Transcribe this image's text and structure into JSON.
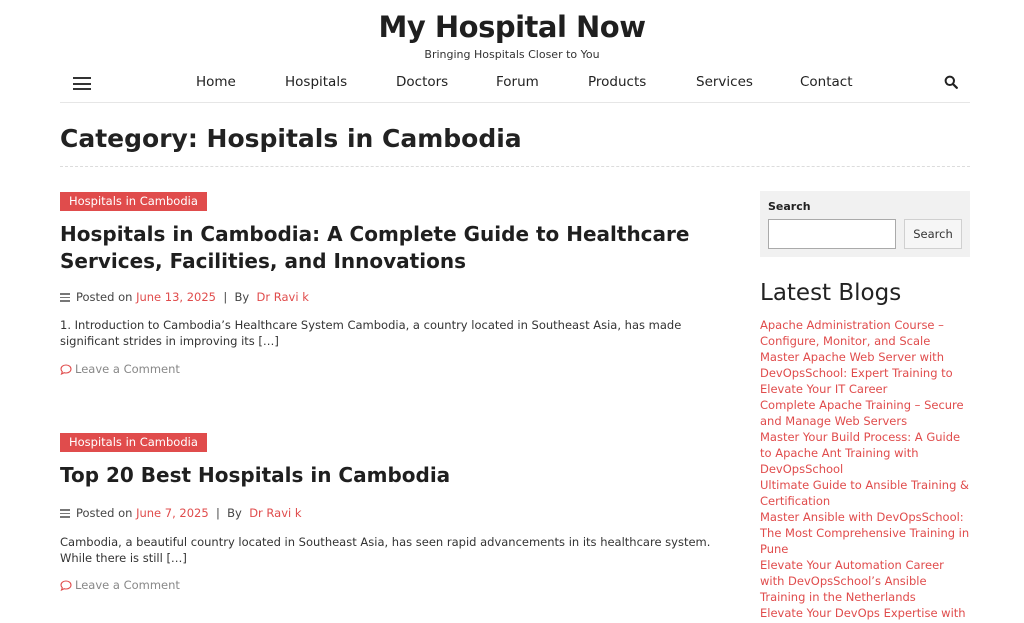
{
  "site": {
    "title": "My Hospital Now",
    "tagline": "Bringing Hospitals Closer to You"
  },
  "nav": {
    "items": [
      "Home",
      "Hospitals",
      "Doctors",
      "Forum",
      "Products",
      "Services",
      "Contact"
    ]
  },
  "category": {
    "title": "Category: Hospitals in Cambodia"
  },
  "posts": [
    {
      "badge": "Hospitals in Cambodia",
      "title": "Hospitals in Cambodia: A Complete Guide to Healthcare Services, Facilities, and Innovations",
      "posted_on": "Posted on",
      "date": "June 13, 2025",
      "sep": "|",
      "by": "By",
      "author": "Dr Ravi k",
      "excerpt": "1. Introduction to Cambodia’s Healthcare System Cambodia, a country located in Southeast Asia, has made significant strides in improving its […]",
      "comment": "Leave a Comment"
    },
    {
      "badge": "Hospitals in Cambodia",
      "title": "Top 20 Best Hospitals in Cambodia",
      "posted_on": "Posted on",
      "date": "June 7, 2025",
      "sep": "|",
      "by": "By",
      "author": "Dr Ravi k",
      "excerpt": "Cambodia, a beautiful country located in Southeast Asia, has seen rapid advancements in its healthcare system. While there is still […]",
      "comment": "Leave a Comment"
    }
  ],
  "sidebar": {
    "search_label": "Search",
    "search_placeholder": "",
    "search_button": "Search",
    "latest_title": "Latest Blogs",
    "blogs": [
      "Apache Administration Course – Configure, Monitor, and Scale",
      "Master Apache Web Server with DevOpsSchool: Expert Training to Elevate Your IT Career",
      "Complete Apache Training – Secure and Manage Web Servers",
      "Master Your Build Process: A Guide to Apache Ant Training with DevOpsSchool",
      "Ultimate Guide to Ansible Training & Certification",
      "Master Ansible with DevOpsSchool: The Most Comprehensive Training in Pune",
      "Elevate Your Automation Career with DevOpsSchool’s Ansible Training in the Netherlands",
      "Elevate Your DevOps Expertise with"
    ]
  },
  "colors": {
    "accent": "#e04c4c",
    "text": "#222222",
    "sidebar_bg": "#f1f1f1"
  },
  "icons": {
    "menu": "hamburger-icon",
    "search": "search-icon",
    "meta": "list-icon",
    "comment": "comment-icon"
  }
}
